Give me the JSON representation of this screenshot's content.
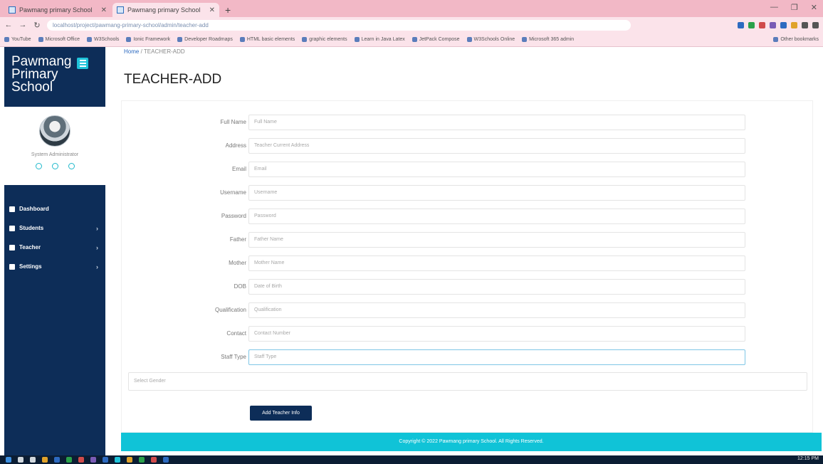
{
  "browser": {
    "tabs": [
      {
        "title": "Pawmang primary School",
        "active": false
      },
      {
        "title": "Pawmang primary School",
        "active": true
      }
    ],
    "new_tab_label": "+",
    "url": "localhost/project/pawmang-primary-school/admin/teacher-add",
    "bookmarks": [
      "YouTube",
      "Microsoft Office",
      "W3Schools",
      "Ionic Framework",
      "Developer Roadmaps",
      "HTML basic elements",
      "graphic elements",
      "Learn in Java Latex",
      "JetPack Compose",
      "W3Schools Online",
      "Microsoft 365 admin"
    ],
    "other_bookmarks": "Other bookmarks"
  },
  "sidebar": {
    "brand": "Pawmang Primary School",
    "profile_name": "System Administrator",
    "nav": [
      {
        "label": "Dashboard",
        "has_children": false
      },
      {
        "label": "Students",
        "has_children": true
      },
      {
        "label": "Teacher",
        "has_children": true
      },
      {
        "label": "Settings",
        "has_children": true
      }
    ]
  },
  "breadcrumb": {
    "home": "Home",
    "separator": "/",
    "current": "TEACHER-ADD"
  },
  "page_title": "TEACHER-ADD",
  "form": {
    "fields": [
      {
        "label": "Full Name",
        "placeholder": "Full Name"
      },
      {
        "label": "Address",
        "placeholder": "Teacher Current Address"
      },
      {
        "label": "Email",
        "placeholder": "Email"
      },
      {
        "label": "Username",
        "placeholder": "Username"
      },
      {
        "label": "Password",
        "placeholder": "Password"
      },
      {
        "label": "Father",
        "placeholder": "Father Name"
      },
      {
        "label": "Mother",
        "placeholder": "Mother Name"
      },
      {
        "label": "DOB",
        "placeholder": "Date of Birth"
      },
      {
        "label": "Qualification",
        "placeholder": "Qualification"
      },
      {
        "label": "Contact",
        "placeholder": "Contact Number"
      },
      {
        "label": "Staff Type",
        "placeholder": "Staff Type"
      }
    ],
    "gender_select": "Select Gender",
    "submit_label": "Add Teacher Info"
  },
  "footer": "Copyright © 2022 Pawmang primary School. All Rights Reserved.",
  "taskbar": {
    "clock": "12:15 PM"
  },
  "colors": {
    "sidebar": "#0d2d58",
    "accent": "#10c3d7",
    "button": "#0d2d58"
  }
}
